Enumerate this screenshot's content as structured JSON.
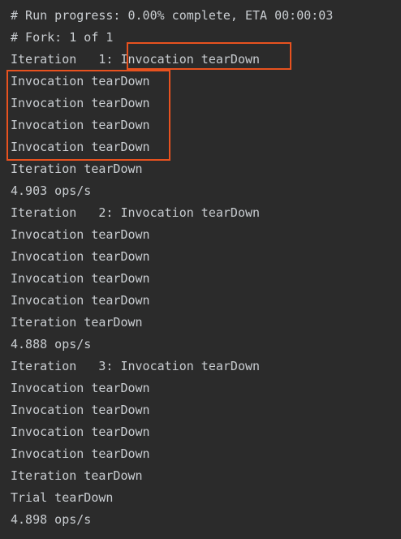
{
  "console": {
    "lines": [
      "# Run progress: 0.00% complete, ETA 00:00:03",
      "# Fork: 1 of 1",
      "Iteration   1: Invocation tearDown",
      "Invocation tearDown",
      "Invocation tearDown",
      "Invocation tearDown",
      "Invocation tearDown",
      "Iteration tearDown",
      "4.903 ops/s",
      "Iteration   2: Invocation tearDown",
      "Invocation tearDown",
      "Invocation tearDown",
      "Invocation tearDown",
      "Invocation tearDown",
      "Iteration tearDown",
      "4.888 ops/s",
      "Iteration   3: Invocation tearDown",
      "Invocation tearDown",
      "Invocation tearDown",
      "Invocation tearDown",
      "Invocation tearDown",
      "Iteration tearDown",
      "Trial tearDown",
      "4.898 ops/s"
    ]
  },
  "colors": {
    "background": "#2b2b2b",
    "text": "#c9cdd1",
    "highlight": "#e8521f"
  }
}
